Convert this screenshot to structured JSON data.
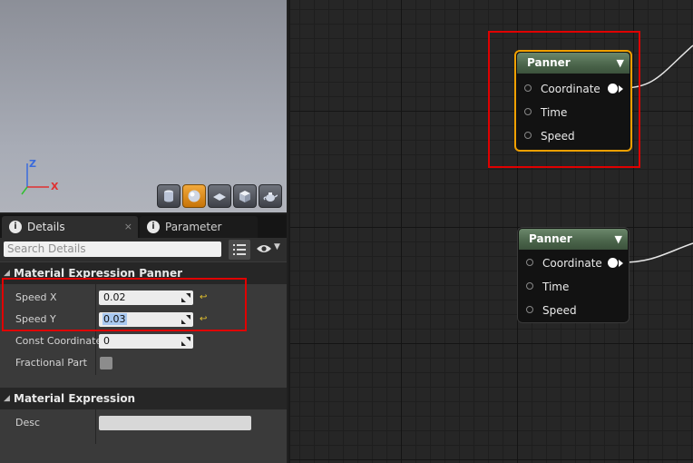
{
  "viewport": {
    "axis_z": "Z",
    "axis_x": "X",
    "buttons": [
      "cylinder-icon",
      "sphere-icon",
      "plane-icon",
      "cube-icon",
      "teapot-icon"
    ],
    "active_button": 1
  },
  "tabs": [
    {
      "label": "Details",
      "icon": "info-icon",
      "close": "×"
    },
    {
      "label": "Parameter Defaults",
      "icon": "info-icon"
    }
  ],
  "search": {
    "placeholder": "Search Details"
  },
  "categories": [
    {
      "label": "Material Expression Panner"
    },
    {
      "label": "Material Expression"
    }
  ],
  "properties": [
    {
      "label": "Speed X",
      "value": "0.02"
    },
    {
      "label": "Speed Y",
      "value": "0.03",
      "selected": true
    },
    {
      "label": "Const Coordinate",
      "value": "0"
    },
    {
      "label": "Fractional Part",
      "checked": false
    },
    {
      "label": "Desc",
      "value": ""
    }
  ],
  "nodes": [
    {
      "title": "Panner",
      "selected": true,
      "pins": [
        "Coordinate",
        "Time",
        "Speed"
      ]
    },
    {
      "title": "Panner",
      "selected": false,
      "pins": [
        "Coordinate",
        "Time",
        "Speed"
      ]
    }
  ],
  "colors": {
    "highlight": "#e00000",
    "selection": "#f0a000",
    "node_header": "#4a644a"
  }
}
